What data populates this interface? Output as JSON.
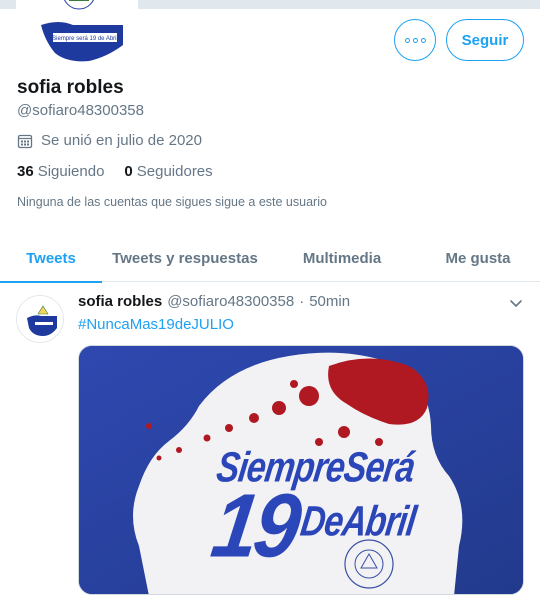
{
  "profile": {
    "display_name": "sofia robles",
    "handle": "@sofiaro48300358",
    "joined": "Se unió en julio de 2020",
    "following_count": "36",
    "following_label": "Siguiendo",
    "followers_count": "0",
    "followers_label": "Seguidores",
    "follow_note": "Ninguna de las cuentas que sigues sigue a este usuario",
    "follow_button": "Seguir",
    "avatar_banner_text": "Siempre será 19 de Abril"
  },
  "tabs": [
    {
      "label": "Tweets",
      "active": true
    },
    {
      "label": "Tweets y respuestas",
      "active": false
    },
    {
      "label": "Multimedia",
      "active": false
    },
    {
      "label": "Me gusta",
      "active": false
    }
  ],
  "tweet": {
    "name": "sofia robles",
    "handle": "@sofiaro48300358",
    "separator": "·",
    "time": "50min",
    "hashtag": "#NuncaMas19deJULIO",
    "media": {
      "line1": "SiempreSerá",
      "number": "19",
      "line2": "DeAbril"
    }
  },
  "colors": {
    "accent": "#1da1f2",
    "text_primary": "#14171a",
    "text_secondary": "#657786",
    "media_blue": "#2a3f9a",
    "blood_red": "#b01822"
  },
  "icons": {
    "more": "more-dots-icon",
    "calendar": "calendar-icon",
    "chevron": "chevron-down-icon"
  }
}
